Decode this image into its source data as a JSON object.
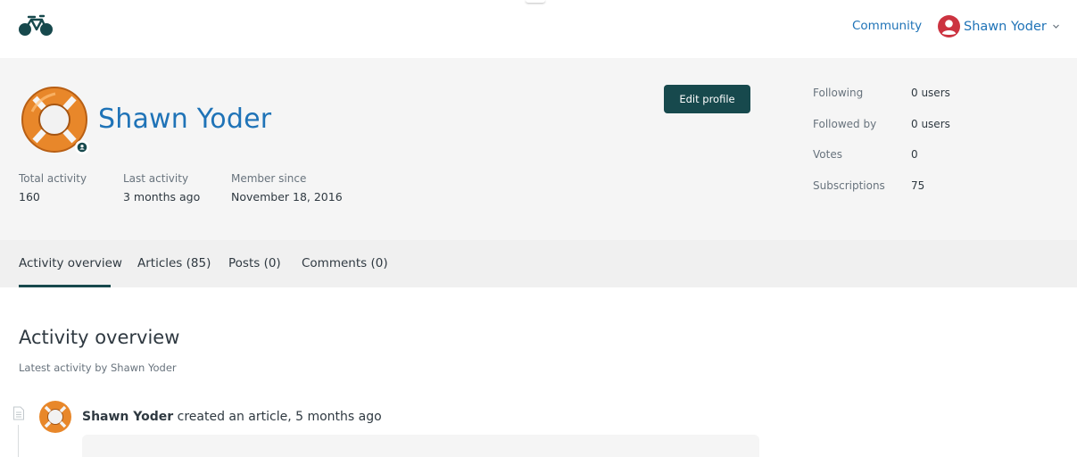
{
  "header": {
    "logo_icon": "bicycle-icon",
    "community_link": "Community",
    "user_name": "Shawn Yoder",
    "user_icon": "user-circle-icon",
    "caret_icon": "chevron-down-icon",
    "brand_color": "#17494d",
    "link_color": "#1f73b7",
    "user_icon_color": "#cc3340"
  },
  "profile": {
    "name": "Shawn Yoder",
    "avatar_icon": "lifebuoy-avatar",
    "badge_icon": "user-badge-icon",
    "edit_button": "Edit profile",
    "stats": [
      {
        "label": "Total activity",
        "value": "160"
      },
      {
        "label": "Last activity",
        "value": "3 months ago"
      },
      {
        "label": "Member since",
        "value": "November 18, 2016"
      }
    ],
    "side_stats": [
      {
        "label": "Following",
        "value": "0 users"
      },
      {
        "label": "Followed by",
        "value": "0 users"
      },
      {
        "label": "Votes",
        "value": "0"
      },
      {
        "label": "Subscriptions",
        "value": "75"
      }
    ]
  },
  "tabs": [
    {
      "label": "Activity overview",
      "active": true
    },
    {
      "label": "Articles (85)",
      "active": false
    },
    {
      "label": "Posts (0)",
      "active": false
    },
    {
      "label": "Comments (0)",
      "active": false
    }
  ],
  "content": {
    "title": "Activity overview",
    "subtitle": "Latest activity by Shawn Yoder",
    "activities": [
      {
        "icon": "document-icon",
        "author": "Shawn Yoder",
        "action": " created an article, 5 months ago"
      }
    ]
  }
}
